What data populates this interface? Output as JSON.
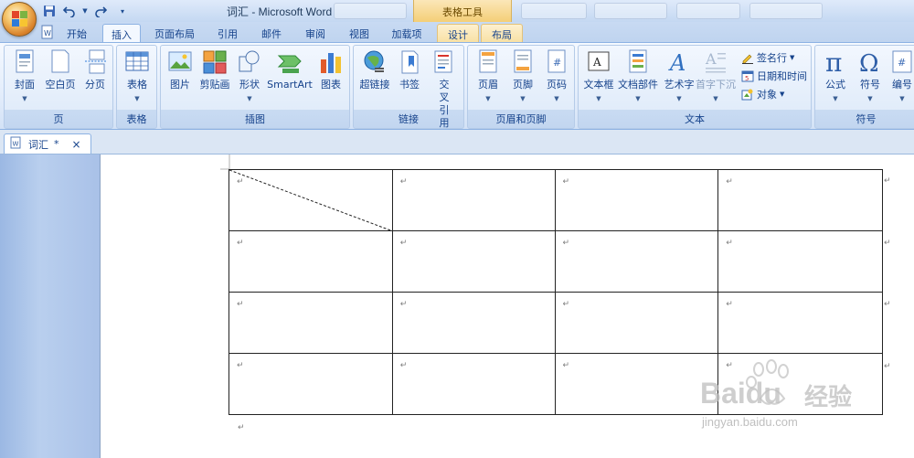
{
  "window": {
    "title": "词汇 - Microsoft Word",
    "context_tools_label": "表格工具"
  },
  "quick_access": {
    "icons": [
      "word-doc-icon",
      "save-icon",
      "undo-icon",
      "redo-icon",
      "customize-qat-icon"
    ]
  },
  "tabs": [
    {
      "label": "开始"
    },
    {
      "label": "插入"
    },
    {
      "label": "页面布局"
    },
    {
      "label": "引用"
    },
    {
      "label": "邮件"
    },
    {
      "label": "审阅"
    },
    {
      "label": "视图"
    },
    {
      "label": "加载项"
    },
    {
      "label": "设计"
    },
    {
      "label": "布局"
    }
  ],
  "ribbon": {
    "groups": [
      {
        "label": "页",
        "buttons": [
          "封面",
          "空白页",
          "分页"
        ]
      },
      {
        "label": "表格",
        "buttons": [
          "表格"
        ]
      },
      {
        "label": "插图",
        "buttons": [
          "图片",
          "剪贴画",
          "形状",
          "SmartArt",
          "图表"
        ]
      },
      {
        "label": "链接",
        "buttons": [
          "超链接",
          "书签",
          "交叉引用"
        ]
      },
      {
        "label": "页眉和页脚",
        "buttons": [
          "页眉",
          "页脚",
          "页码"
        ]
      },
      {
        "label": "文本",
        "buttons": [
          "文本框",
          "文档部件",
          "艺术字",
          "首字下沉"
        ],
        "small": [
          "签名行",
          "日期和时间",
          "对象"
        ]
      },
      {
        "label": "符号",
        "buttons": [
          "公式",
          "符号",
          "编号"
        ]
      }
    ]
  },
  "document_tab": {
    "name": "词汇",
    "modified_mark": "*",
    "close": "×"
  },
  "paragraph_mark": "↵",
  "watermark": {
    "brand": "Baidu",
    "text": "经验",
    "url": "jingyan.baidu.com"
  },
  "colors": {
    "ribbon_text": "#15428b",
    "context_tab": "#f4cf77",
    "page": "#ffffff",
    "left_pane": "#a9c1e8"
  }
}
